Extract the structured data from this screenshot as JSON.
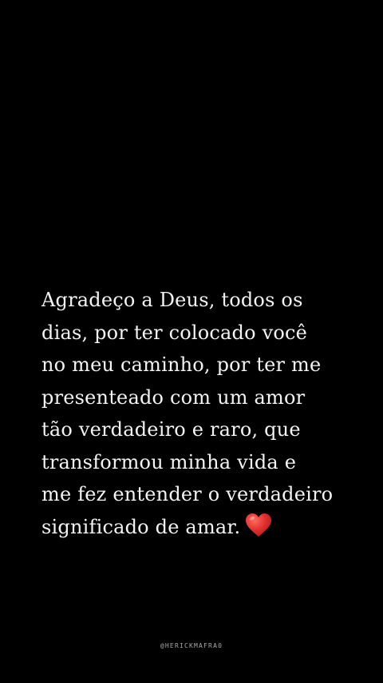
{
  "quote": {
    "lines": [
      "Agradeço a Deus, todos os",
      "dias, por ter colocado você",
      "no meu caminho, por ter me",
      "presenteado com um amor",
      "tão verdadeiro e raro, que",
      "transformou minha vida e",
      "me fez entender o verdadeiro",
      "significado de amar."
    ],
    "emoji_icon": "red-heart-icon"
  },
  "footer": {
    "handle": "@HERICKMAFRA0"
  },
  "colors": {
    "background": "#000000",
    "text": "#f3f3f3",
    "handle": "#a8a8a8",
    "heart": "#e0312e"
  }
}
